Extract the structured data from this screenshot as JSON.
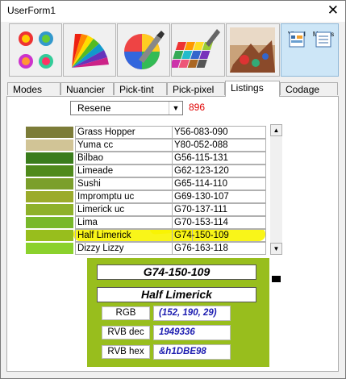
{
  "window": {
    "title": "UserForm1",
    "close_symbol": "✕"
  },
  "toolbar": {
    "visual_basic_label": "Visual Basic",
    "macros_label": "Macros"
  },
  "tabs": [
    {
      "label": "Modes"
    },
    {
      "label": "Nuancier"
    },
    {
      "label": "Pick-tint"
    },
    {
      "label": "Pick-pixel"
    },
    {
      "label": "Listings"
    },
    {
      "label": "Codage"
    }
  ],
  "active_tab": "Listings",
  "palette_select": {
    "value": "Resene"
  },
  "count": "896",
  "rows": [
    {
      "name": "Grass Hopper",
      "code": "Y56-083-090",
      "color": "#7c7c38"
    },
    {
      "name": "Yuma cc",
      "code": "Y80-052-088",
      "color": "#d1c496"
    },
    {
      "name": "Bilbao",
      "code": "G56-115-131",
      "color": "#3a7d1c"
    },
    {
      "name": "Limeade",
      "code": "G62-123-120",
      "color": "#4f8a1b"
    },
    {
      "name": "Sushi",
      "code": "G65-114-110",
      "color": "#7b9f2b"
    },
    {
      "name": "Impromptu uc",
      "code": "G69-130-107",
      "color": "#9bab2b"
    },
    {
      "name": "Limerick uc",
      "code": "G70-137-111",
      "color": "#8eb12a"
    },
    {
      "name": "Lima",
      "code": "G70-153-114",
      "color": "#78b82a"
    },
    {
      "name": "Half Limerick",
      "code": "G74-150-109",
      "color": "#98be1d"
    },
    {
      "name": "Dizzy Lizzy",
      "code": "G76-163-118",
      "color": "#8bd12d"
    }
  ],
  "detail": {
    "code": "G74-150-109",
    "name": "Half Limerick",
    "rgb_label": "RGB",
    "rgb_value": "(152, 190, 29)",
    "rvb_dec_label": "RVB dec",
    "rvb_dec_value": "1949336",
    "rvb_hex_label": "RVB hex",
    "rvb_hex_value": "&h1DBE98",
    "color": "#98be1d"
  },
  "highlight_color": "#f8f400"
}
